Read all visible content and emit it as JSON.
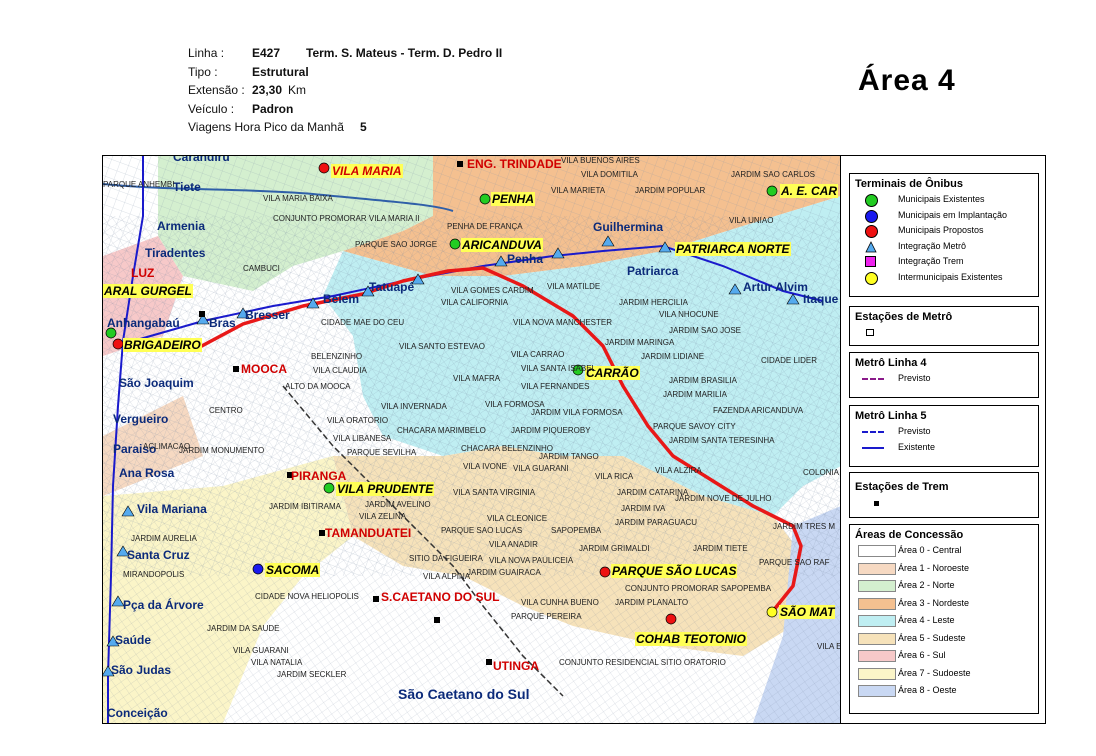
{
  "header": {
    "linha_label": "Linha :",
    "linha_code": "E427",
    "linha_name": "Term. S. Mateus - Term. D. Pedro II",
    "tipo_label": "Tipo :",
    "tipo_value": "Estrutural",
    "extensao_label": "Extensão :",
    "extensao_value": "23,30",
    "extensao_unit": "Km",
    "veiculo_label": "Veículo :",
    "veiculo_value": "Padron",
    "viagens_label": "Viagens Hora Pico da Manhã",
    "viagens_value": "5"
  },
  "area_title": "Área  4",
  "legend": {
    "terminais_title": "Terminais de Ônibus",
    "terminais": [
      {
        "label": "Municipais Existentes",
        "color": "#22cc22",
        "shape": "circle"
      },
      {
        "label": "Municipais em Implantação",
        "color": "#1a1aee",
        "shape": "circle"
      },
      {
        "label": "Municipais Propostos",
        "color": "#ee1111",
        "shape": "circle"
      },
      {
        "label": "Integração Metrô",
        "color": "#55aaee",
        "shape": "triangle"
      },
      {
        "label": "Integração Trem",
        "color": "#ee22ee",
        "shape": "square"
      },
      {
        "label": "Intermunicipais Existentes",
        "color": "#ffff22",
        "shape": "circle"
      }
    ],
    "metro_stations_title": "Estações de Metrô",
    "metro4_title": "Metrô Linha 4",
    "metro4_items": [
      {
        "label": "Previsto",
        "color": "#8a1a8a",
        "style": "dashed"
      }
    ],
    "metro5_title": "Metrô Linha 5",
    "metro5_items": [
      {
        "label": "Previsto",
        "color": "#1a1acc",
        "style": "dashed"
      },
      {
        "label": "Existente",
        "color": "#1a1acc",
        "style": "solid"
      }
    ],
    "train_stations_title": "Estações de Trem",
    "areas_title": "Áreas de Concessão",
    "areas": [
      {
        "label": "Área 0 - Central",
        "color": "#ffffff"
      },
      {
        "label": "Área 1 - Noroeste",
        "color": "#f6d9c2"
      },
      {
        "label": "Área 2 - Norte",
        "color": "#d4efcf"
      },
      {
        "label": "Área 3 - Nordeste",
        "color": "#f4c090"
      },
      {
        "label": "Área 4 - Leste",
        "color": "#bfeef2"
      },
      {
        "label": "Área 5 - Sudeste",
        "color": "#f6e2ba"
      },
      {
        "label": "Área 6 - Sul",
        "color": "#f7c9c9"
      },
      {
        "label": "Área 7 - Sudoeste",
        "color": "#fbf5c8"
      },
      {
        "label": "Área 8 - Oeste",
        "color": "#c9d8f3"
      }
    ]
  },
  "map": {
    "line_color": "#e81818",
    "labels_highlight": [
      "VILA MARIA",
      "PENHA",
      "ARICANDUVA",
      "A. E. CAR",
      "PATRIARCA NORTE",
      "CARRÃO",
      "VILA PRUDENTE",
      "PARQUE SÃO LUCAS",
      "COHAB TEOTONIO",
      "SÃO MAT",
      "SACOMA",
      "BRIGADEIRO",
      "ARAL GURGEL"
    ],
    "labels_red": [
      "ENG. TRINDADE",
      "MOOCA",
      "PIRANGA",
      "TAMANDUATEI",
      "S.CAETANO DO SUL",
      "UTINGA",
      "LUZ"
    ],
    "stations": [
      "Carandiru",
      "Tiete",
      "Armenia",
      "Tiradentes",
      "Anhangabaú",
      "Bras",
      "Bresser",
      "Belem",
      "Tatuapé",
      "Penha",
      "Guilhermina",
      "Patriarca",
      "Artur Alvim",
      "Itaque",
      "São Joaquim",
      "Vergueiro",
      "Paraiso",
      "Ana Rosa",
      "Vila Mariana",
      "Santa Cruz",
      "Pça da Árvore",
      "Saúde",
      "São Judas",
      "Conceição"
    ],
    "city_label": "São Caetano do Sul",
    "streets": [
      "PARQUE ANHEMBI",
      "VILA MARIA BAIXA",
      "CONJUNTO PROMORAR VILA MARIA II",
      "PENHA DE FRANÇA",
      "VILA BUENOS AIRES",
      "VILA DOMITILA",
      "VILA MARIETA",
      "JARDIM POPULAR",
      "JARDIM SAO CARLOS",
      "VILA UNIAO",
      "PARQUE SAO JORGE",
      "VILA GOMES CARDIM",
      "VILA CALIFORNIA",
      "VILA MATILDE",
      "JARDIM HERCILIA",
      "VILA NHOCUNE",
      "JARDIM SAO JOSE",
      "CIDADE MAE DO CEU",
      "VILA NOVA MANCHESTER",
      "VILA SANTO ESTEVAO",
      "VILA CARRAO",
      "JARDIM MARINGA",
      "JARDIM LIDIANE",
      "CIDADE LIDER",
      "BELENZINHO",
      "VILA CLAUDIA",
      "ALTO DA MOOCA",
      "VILA SANTA ISABEL",
      "VILA FERNANDES",
      "JARDIM BRASILIA",
      "VILA MAFRA",
      "VILA FORMOSA",
      "JARDIM MARILIA",
      "VILA INVERNADA",
      "JARDIM VILA FORMOSA",
      "FAZENDA ARICANDUVA",
      "VILA ORATORIO",
      "CHACARA MARIMBELO",
      "JARDIM PIQUEROBY",
      "PARQUE SAVOY CITY",
      "VILA LIBANESA",
      "CHACARA BELENZINHO",
      "JARDIM SANTA TERESINHA",
      "PARQUE SEVILHA",
      "JARDIM TANGO",
      "JARDIM MONUMENTO",
      "VILA IVONE",
      "VILA GUARANI",
      "VILA ALZIRA",
      "COLONIA",
      "VILA RICA",
      "VILA SANTA VIRGINIA",
      "JARDIM CATARINA",
      "JARDIM NOVE DE JULHO",
      "JARDIM IBITIRAMA",
      "JARDIM AVELINO",
      "JARDIM IVA",
      "VILA ZELINA",
      "VILA CLEONICE",
      "JARDIM PARAGUACU",
      "JARDIM TRES M",
      "PARQUE SAO LUCAS",
      "SAPOPEMBA",
      "VILA ANADIR",
      "JARDIM GRIMALDI",
      "JARDIM TIETE",
      "SITIO DA FIGUEIRA",
      "VILA NOVA PAULICEIA",
      "PARQUE SAO RAF",
      "VILA ALPINA",
      "JARDIM GUAIRACA",
      "CONJUNTO PROMORAR SAPOPEMBA",
      "CIDADE NOVA HELIOPOLIS",
      "VILA CUNHA BUENO",
      "JARDIM PLANALTO",
      "PARQUE PEREIRA",
      "JARDIM DA SAUDE",
      "VILA GUARANI",
      "VILA NATALIA",
      "JARDIM SECKLER",
      "CONJUNTO RESIDENCIAL SITIO ORATORIO",
      "JARDIM AURELIA",
      "MIRANDOPOLIS",
      "CAMBUCI",
      "ACLIMACAO",
      "CENTRO",
      "VILA ESTE",
      "JARDIM IVA"
    ]
  }
}
